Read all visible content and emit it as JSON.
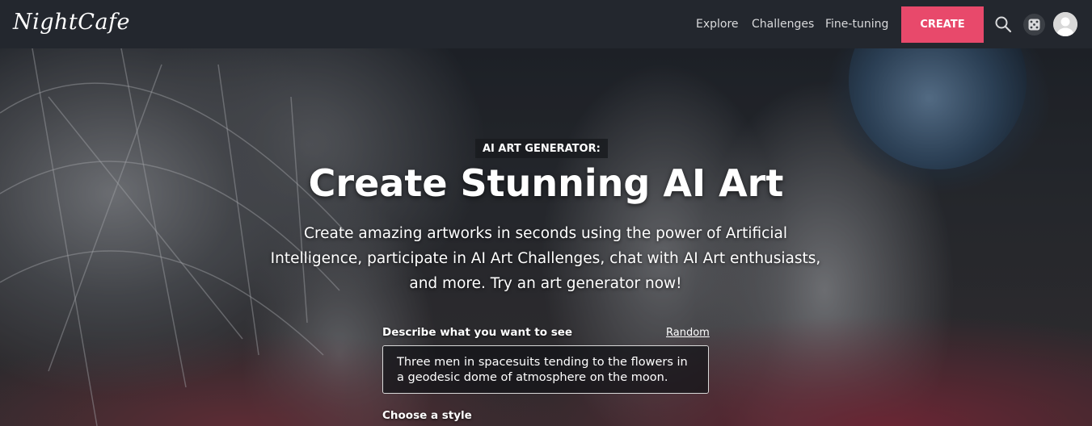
{
  "header": {
    "logo": "NightCafe",
    "nav": [
      {
        "label": "Explore"
      },
      {
        "label": "Challenges"
      },
      {
        "label": "Fine-tuning"
      }
    ],
    "create_label": "CREATE",
    "icons": [
      "search-icon",
      "dice-icon",
      "avatar-icon"
    ]
  },
  "hero": {
    "badge": "AI ART GENERATOR:",
    "title": "Create Stunning AI Art",
    "subtitle": "Create amazing artworks in seconds using the power of Artificial Intelligence, participate in AI Art Challenges, chat with AI Art enthusiasts, and more. Try an art generator now!",
    "describe_label": "Describe what you want to see",
    "random_label": "Random",
    "prompt_value": "Three men in spacesuits tending to the flowers in a geodesic dome of atmosphere on the moon.",
    "style_label": "Choose a style"
  },
  "colors": {
    "accent": "#e8496b",
    "header_bg": "#23272e"
  }
}
